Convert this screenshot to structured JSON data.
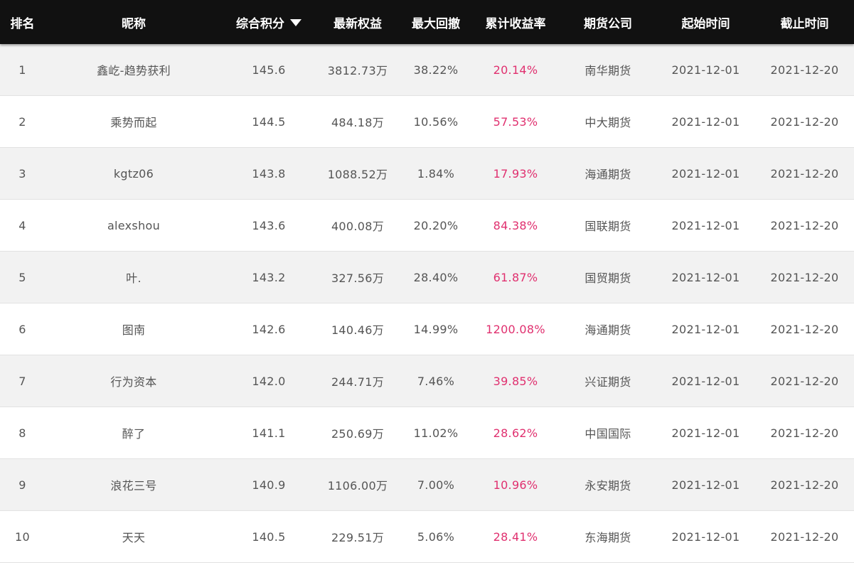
{
  "table": {
    "headers": {
      "rank": "排名",
      "nickname": "昵称",
      "score": "综合积分",
      "equity": "最新权益",
      "drawdown": "最大回撤",
      "return_rate": "累计收益率",
      "broker": "期货公司",
      "start": "起始时间",
      "end": "截止时间"
    },
    "sort": {
      "column": "score",
      "direction": "desc"
    },
    "rows": [
      {
        "rank": "1",
        "nickname": "鑫屹-趋势获利",
        "score": "145.6",
        "equity": "3812.73万",
        "drawdown": "38.22%",
        "return_rate": "20.14%",
        "broker": "南华期货",
        "start": "2021-12-01",
        "end": "2021-12-20"
      },
      {
        "rank": "2",
        "nickname": "乘势而起",
        "score": "144.5",
        "equity": "484.18万",
        "drawdown": "10.56%",
        "return_rate": "57.53%",
        "broker": "中大期货",
        "start": "2021-12-01",
        "end": "2021-12-20"
      },
      {
        "rank": "3",
        "nickname": "kgtz06",
        "score": "143.8",
        "equity": "1088.52万",
        "drawdown": "1.84%",
        "return_rate": "17.93%",
        "broker": "海通期货",
        "start": "2021-12-01",
        "end": "2021-12-20"
      },
      {
        "rank": "4",
        "nickname": "alexshou",
        "score": "143.6",
        "equity": "400.08万",
        "drawdown": "20.20%",
        "return_rate": "84.38%",
        "broker": "国联期货",
        "start": "2021-12-01",
        "end": "2021-12-20"
      },
      {
        "rank": "5",
        "nickname": "叶.",
        "score": "143.2",
        "equity": "327.56万",
        "drawdown": "28.40%",
        "return_rate": "61.87%",
        "broker": "国贸期货",
        "start": "2021-12-01",
        "end": "2021-12-20"
      },
      {
        "rank": "6",
        "nickname": "图南",
        "score": "142.6",
        "equity": "140.46万",
        "drawdown": "14.99%",
        "return_rate": "1200.08%",
        "broker": "海通期货",
        "start": "2021-12-01",
        "end": "2021-12-20"
      },
      {
        "rank": "7",
        "nickname": "行为资本",
        "score": "142.0",
        "equity": "244.71万",
        "drawdown": "7.46%",
        "return_rate": "39.85%",
        "broker": "兴证期货",
        "start": "2021-12-01",
        "end": "2021-12-20"
      },
      {
        "rank": "8",
        "nickname": "醉了",
        "score": "141.1",
        "equity": "250.69万",
        "drawdown": "11.02%",
        "return_rate": "28.62%",
        "broker": "中国国际",
        "start": "2021-12-01",
        "end": "2021-12-20"
      },
      {
        "rank": "9",
        "nickname": "浪花三号",
        "score": "140.9",
        "equity": "1106.00万",
        "drawdown": "7.00%",
        "return_rate": "10.96%",
        "broker": "永安期货",
        "start": "2021-12-01",
        "end": "2021-12-20"
      },
      {
        "rank": "10",
        "nickname": "天天",
        "score": "140.5",
        "equity": "229.51万",
        "drawdown": "5.06%",
        "return_rate": "28.41%",
        "broker": "东海期货",
        "start": "2021-12-01",
        "end": "2021-12-20"
      }
    ]
  },
  "colors": {
    "header_bg": "#111111",
    "header_text": "#ffffff",
    "row_odd_bg": "#f2f2f2",
    "row_even_bg": "#ffffff",
    "text": "#555555",
    "return_rate": "#e0306f"
  },
  "icons": {
    "sort": "caret-down-icon"
  }
}
